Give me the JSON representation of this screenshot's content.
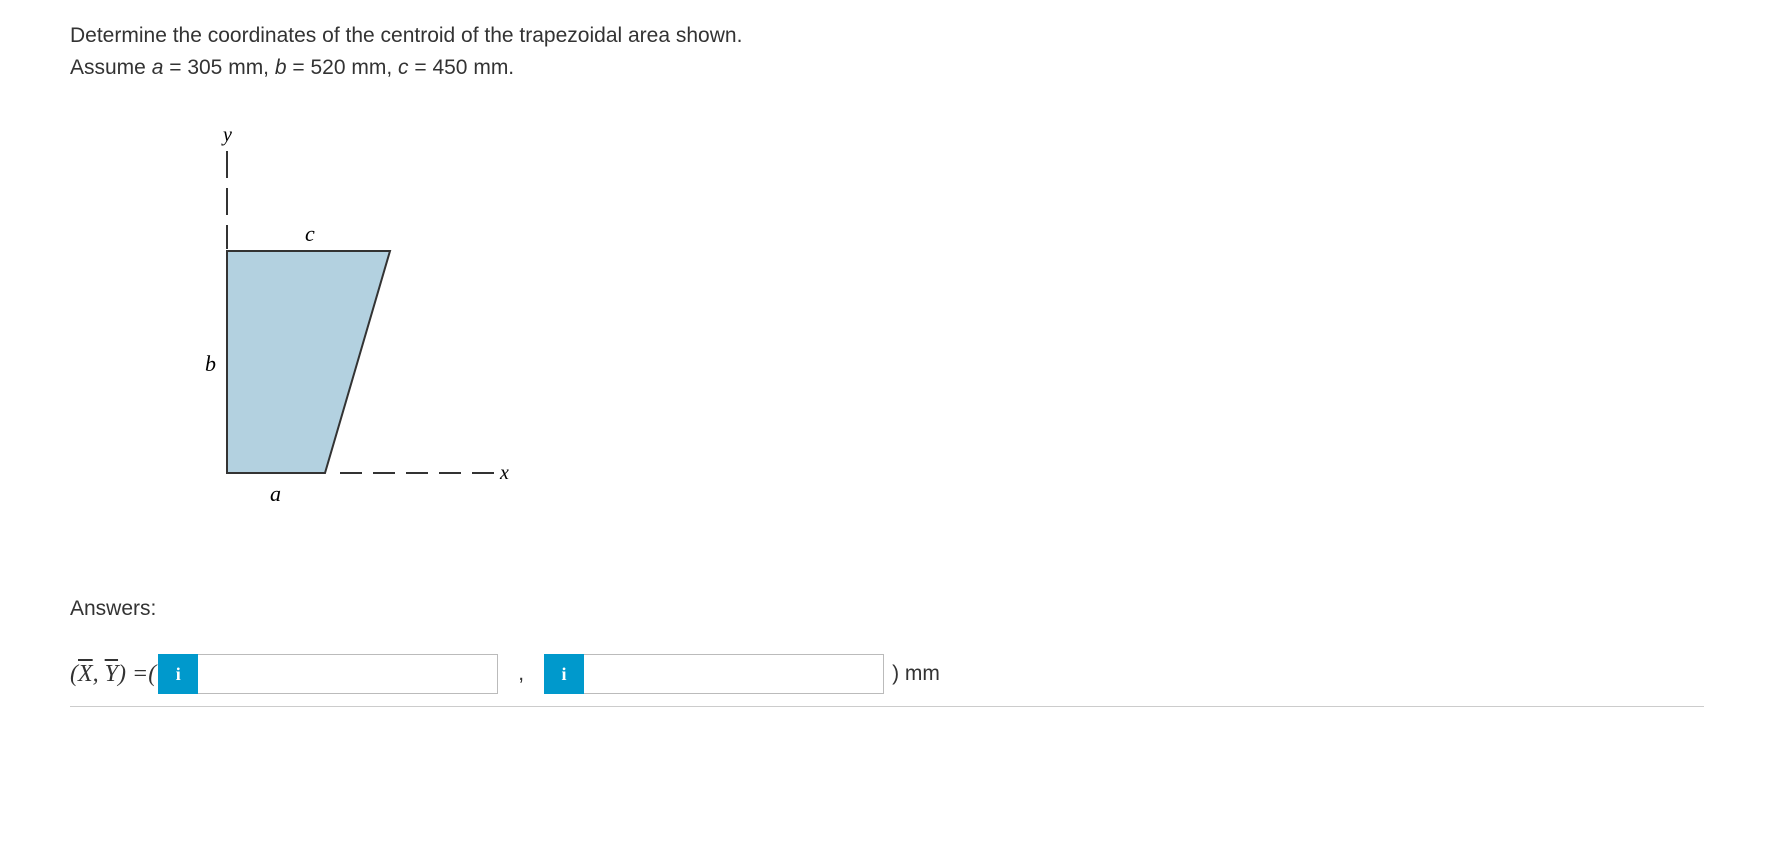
{
  "problem": {
    "line1": "Determine the coordinates of the centroid of the trapezoidal area shown.",
    "line2_pre": "Assume ",
    "a_label": "a",
    "a_val": " = 305 mm, ",
    "b_label": "b",
    "b_val": " = 520 mm, ",
    "c_label": "c",
    "c_val": " = 450 mm."
  },
  "diagram": {
    "y_axis": "y",
    "x_axis": "x",
    "label_a": "a",
    "label_b": "b",
    "label_c": "c"
  },
  "answers": {
    "label": "Answers:",
    "formula_open": "(",
    "xbar": "X",
    "ybar": "Y",
    "formula_mid": ") =(",
    "info": "i",
    "comma": ",",
    "close": ")",
    "unit": "mm"
  }
}
